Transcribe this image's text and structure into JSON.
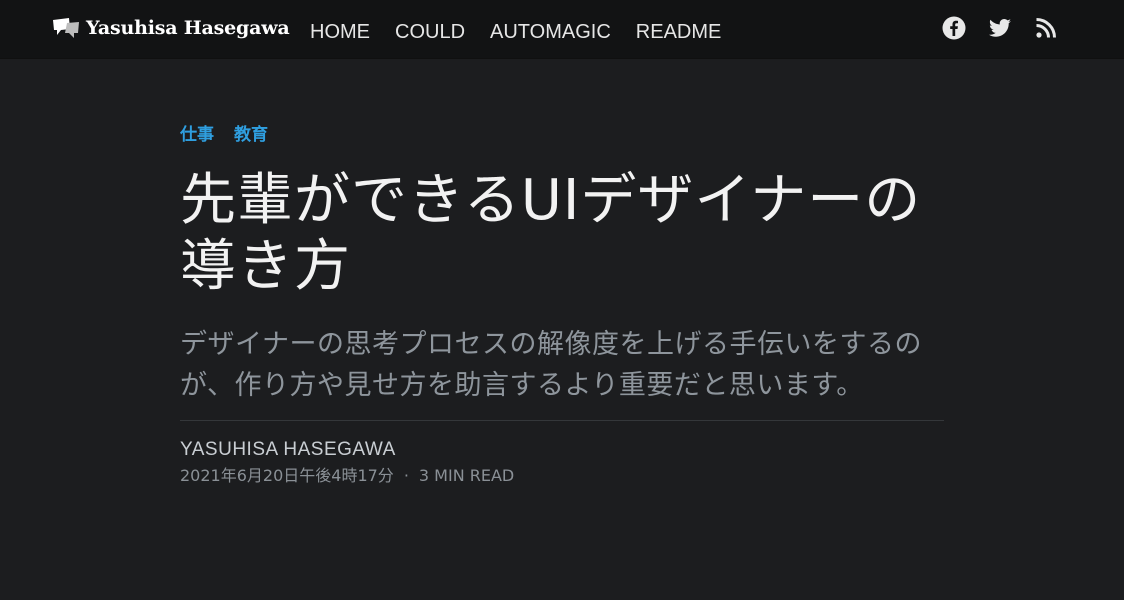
{
  "site": {
    "brand": "Yasuhisa Hasegawa",
    "nav": [
      "HOME",
      "COULD",
      "AUTOMAGIC",
      "README"
    ],
    "social_icons": [
      "facebook-icon",
      "twitter-icon",
      "rss-icon"
    ]
  },
  "article": {
    "tags": [
      "仕事",
      "教育"
    ],
    "title": "先輩ができるUIデザイナーの導き方",
    "subtitle": "デザイナーの思考プロセスの解像度を上げる手伝いをするのが、作り方や見せ方を助言するより重要だと思います。",
    "author": "YASUHISA HASEGAWA",
    "date": "2021年6月20日午後4時17分",
    "separator": "·",
    "read_time": "3 MIN READ"
  },
  "colors": {
    "background": "#1c1d1f",
    "topbar": "#121314",
    "accent": "#2f9fe0",
    "subtitle": "#8e959c"
  }
}
